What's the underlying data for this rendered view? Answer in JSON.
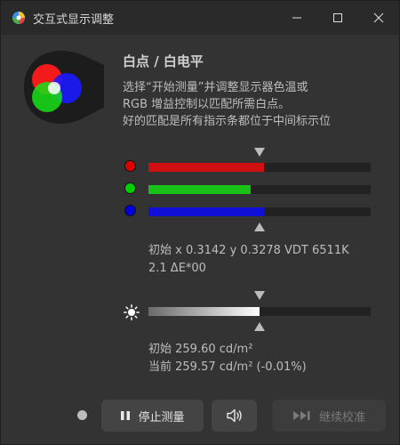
{
  "window": {
    "title": "交互式显示调整",
    "controls": [
      "minimize",
      "maximize",
      "close"
    ]
  },
  "header": {
    "title": "白点 / 白电平",
    "description": [
      "选择“开始测量”并调整显示器色温或",
      "RGB 增益控制以匹配所需白点。",
      "好的匹配是所有指示条都位于中间标示位"
    ]
  },
  "rgb": {
    "channels": [
      {
        "name": "red",
        "dot_color": "#e00000",
        "fill_color": "#d01010",
        "level": 0.52
      },
      {
        "name": "green",
        "dot_color": "#00d000",
        "fill_color": "#18c018",
        "level": 0.46
      },
      {
        "name": "blue",
        "dot_color": "#0000e0",
        "fill_color": "#1010d8",
        "level": 0.52
      }
    ],
    "target_marker": 0.5,
    "info_line1": "初始 x 0.3142 y 0.3278 VDT 6511K",
    "info_line2": "2.1 ΔE*00"
  },
  "luminance": {
    "icon": "sun-icon",
    "level": 0.5,
    "target_marker": 0.5,
    "initial": "初始 259.60 cd/m²",
    "current": "当前 259.57 cd/m² (-0.01%)"
  },
  "controls": {
    "status_dot_color": "#bdbdbd",
    "stop_label": "停止测量",
    "stop_icon": "pause-icon",
    "sound_icon": "speaker-icon",
    "continue_label": "继续校准",
    "continue_icon": "skip-forward-icon",
    "continue_enabled": false
  }
}
